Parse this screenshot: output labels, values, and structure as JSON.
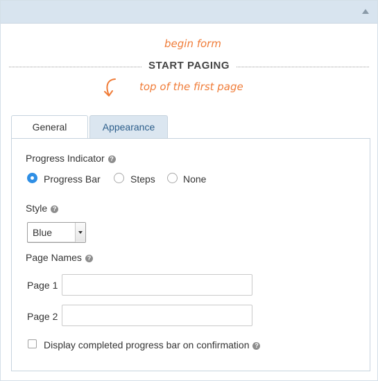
{
  "header": {
    "collapse_icon": "collapse-up-icon"
  },
  "annotations": {
    "begin_form": "begin form",
    "start_paging": "START PAGING",
    "top_of_first_page": "top of the first page",
    "arrow_icon": "curved-arrow-down-icon",
    "accent_color": "#f07c38"
  },
  "tabs": [
    {
      "label": "General",
      "active": true
    },
    {
      "label": "Appearance",
      "active": false
    }
  ],
  "general": {
    "progress_indicator_label": "Progress Indicator",
    "progress_options": [
      {
        "label": "Progress Bar",
        "checked": true
      },
      {
        "label": "Steps",
        "checked": false
      },
      {
        "label": "None",
        "checked": false
      }
    ],
    "style_label": "Style",
    "style_value": "Blue",
    "page_names_label": "Page Names",
    "pages": [
      {
        "label": "Page 1",
        "value": ""
      },
      {
        "label": "Page 2",
        "value": ""
      }
    ],
    "display_completed_label": "Display completed progress bar on confirmation",
    "display_completed_checked": false
  },
  "help_icon": "?",
  "colors": {
    "radio_selected": "#2f8fe5",
    "tab_inactive_bg": "#dbe6f0",
    "topbar_bg": "#d8e4ef"
  }
}
